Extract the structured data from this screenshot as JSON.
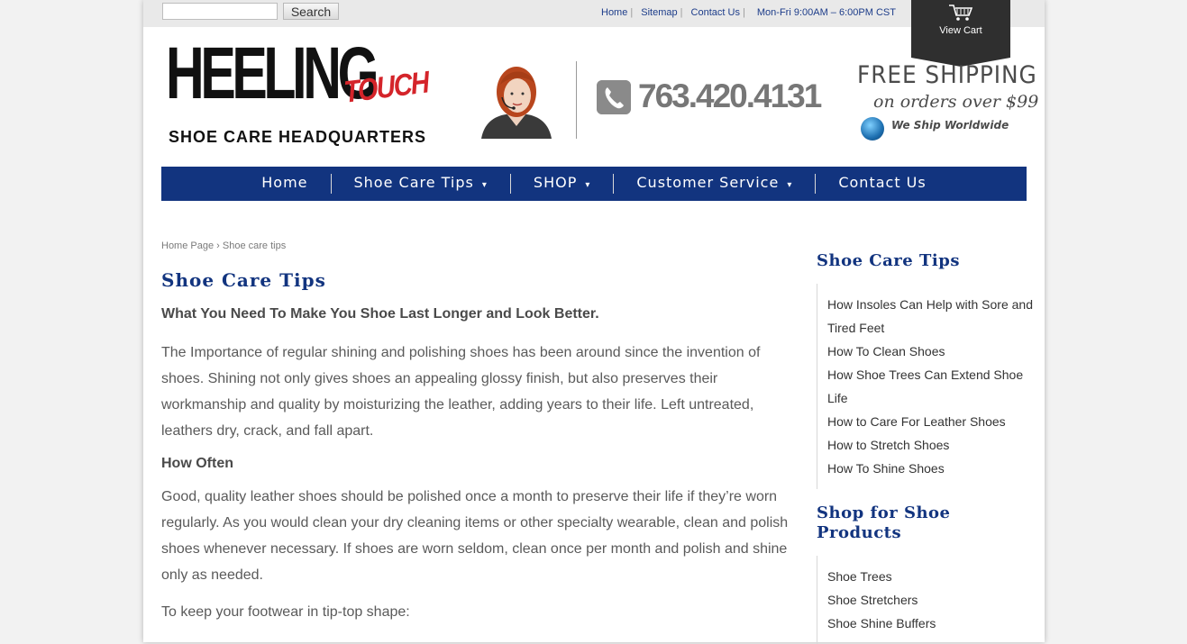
{
  "topbar": {
    "search_placeholder": "",
    "search_button": "Search",
    "links": [
      "Home",
      "Sitemap",
      "Contact Us"
    ],
    "hours": "Mon-Fri 9:00AM – 6:00PM CST"
  },
  "cart": {
    "label": "View Cart",
    "icon": "cart-icon"
  },
  "header": {
    "logo_main": "HEELING",
    "logo_accent": "TOUCH",
    "logo_sub": "SHOE CARE HEADQUARTERS",
    "phone": "763.420.4131",
    "shipping_title": "FREE SHIPPING",
    "shipping_sub": "on orders over $99",
    "shipping_world": "We Ship Worldwide"
  },
  "nav": {
    "items": [
      {
        "label": "Home",
        "dropdown": false
      },
      {
        "label": "Shoe Care Tips",
        "dropdown": true
      },
      {
        "label": "SHOP",
        "dropdown": true
      },
      {
        "label": "Customer Service",
        "dropdown": true
      },
      {
        "label": "Contact Us",
        "dropdown": false
      }
    ]
  },
  "breadcrumb": {
    "home": "Home Page",
    "sep": "›",
    "current": "Shoe care tips"
  },
  "main": {
    "title": "Shoe Care Tips",
    "lead": "What You Need To Make You Shoe Last Longer and Look Better.",
    "p1": "The Importance of regular shining and polishing shoes has been around since the invention of shoes. Shining not only gives shoes an appealing glossy finish, but also preserves their workmanship and quality by moisturizing the leather, adding years to their life. Left untreated, leathers dry, crack, and fall apart.",
    "how_often": "How Often",
    "p2": "Good, quality leather shoes should be polished once a month to preserve their life if they’re worn regularly. As you would clean your dry cleaning items or other specialty wearable, clean and polish shoes whenever necessary. If shoes are worn seldom, clean once per month and polish and shine only as needed.",
    "p3": "To keep your footwear in tip-top shape:"
  },
  "sidebar": {
    "tips_title": "Shoe Care Tips",
    "tips": [
      "How Insoles Can Help with Sore and Tired Feet",
      "How To Clean Shoes",
      "How Shoe Trees Can Extend Shoe Life",
      "How to Care For Leather Shoes",
      "How to Stretch Shoes",
      "How To Shine Shoes"
    ],
    "shop_title": "Shop for Shoe Products",
    "shop": [
      "Shoe Trees",
      "Shoe Stretchers",
      "Shoe Shine Buffers"
    ]
  },
  "colors": {
    "nav_bg": "#12347f",
    "accent_red": "#d4242a",
    "link_blue": "#1d3d8a"
  }
}
